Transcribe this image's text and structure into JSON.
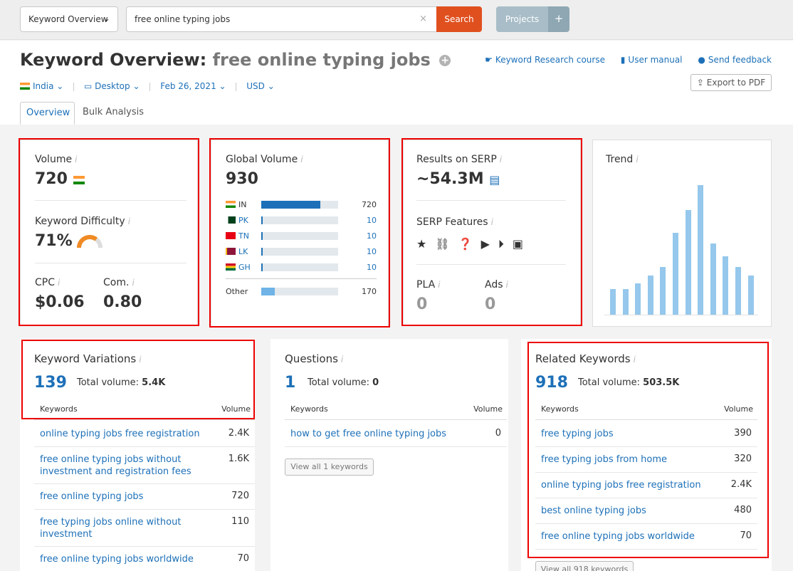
{
  "topbar": {
    "db_select": "Keyword Overview",
    "search_value": "free online typing jobs",
    "search_button": "Search",
    "projects_button": "Projects",
    "plus_button": "+"
  },
  "header": {
    "title_prefix": "Keyword Overview:",
    "title_keyword": "free online typing jobs",
    "links": [
      "Keyword Research course",
      "User manual",
      "Send feedback"
    ],
    "filters": {
      "country": "India",
      "device": "Desktop",
      "date": "Feb 26, 2021",
      "currency": "USD"
    },
    "export_button": "Export to PDF",
    "tabs": [
      "Overview",
      "Bulk Analysis"
    ]
  },
  "volume_card": {
    "volume_label": "Volume",
    "volume_value": "720",
    "kd_label": "Keyword Difficulty",
    "kd_value": "71%",
    "kd_percent": 71,
    "cpc_label": "CPC",
    "cpc_value": "$0.06",
    "com_label": "Com.",
    "com_value": "0.80"
  },
  "global_card": {
    "label": "Global Volume",
    "value": "930",
    "rows": [
      {
        "code": "IN",
        "value": "720",
        "share": 0.77
      },
      {
        "code": "PK",
        "value": "10",
        "share": 0.02
      },
      {
        "code": "TN",
        "value": "10",
        "share": 0.02
      },
      {
        "code": "LK",
        "value": "10",
        "share": 0.02
      },
      {
        "code": "GH",
        "value": "10",
        "share": 0.02
      }
    ],
    "other_label": "Other",
    "other_value": "170",
    "other_share": 0.18
  },
  "serp_card": {
    "results_label": "Results on SERP",
    "results_value": "~54.3M",
    "features_label": "SERP Features",
    "feature_icons": [
      "star-icon",
      "link-icon",
      "question-icon",
      "video-icon",
      "play-icon",
      "briefcase-icon"
    ],
    "pla_label": "PLA",
    "pla_value": "0",
    "ads_label": "Ads",
    "ads_value": "0"
  },
  "trend_card": {
    "label": "Trend",
    "values": [
      0.2,
      0.2,
      0.24,
      0.3,
      0.37,
      0.63,
      0.81,
      1.0,
      0.55,
      0.45,
      0.37,
      0.3
    ]
  },
  "variations": {
    "title": "Keyword Variations",
    "count": "139",
    "total_label": "Total volume: ",
    "total_value": "5.4K",
    "col_kw": "Keywords",
    "col_vol": "Volume",
    "rows": [
      {
        "kw": "online typing jobs free registration",
        "vol": "2.4K"
      },
      {
        "kw": "free online typing jobs without investment and registration fees",
        "vol": "1.6K"
      },
      {
        "kw": "free online typing jobs",
        "vol": "720"
      },
      {
        "kw": "free typing jobs online without investment",
        "vol": "110"
      },
      {
        "kw": "free online typing jobs worldwide",
        "vol": "70"
      }
    ]
  },
  "questions": {
    "title": "Questions",
    "count": "1",
    "total_label": "Total volume: ",
    "total_value": "0",
    "col_kw": "Keywords",
    "col_vol": "Volume",
    "rows": [
      {
        "kw": "how to get free online typing jobs",
        "vol": "0"
      }
    ],
    "view_all": "View all 1 keywords"
  },
  "related": {
    "title": "Related Keywords",
    "count": "918",
    "total_label": "Total volume: ",
    "total_value": "503.5K",
    "col_kw": "Keywords",
    "col_vol": "Volume",
    "rows": [
      {
        "kw": "free typing jobs",
        "vol": "390"
      },
      {
        "kw": "free typing jobs from home",
        "vol": "320"
      },
      {
        "kw": "online typing jobs free registration",
        "vol": "2.4K"
      },
      {
        "kw": "best online typing jobs",
        "vol": "480"
      },
      {
        "kw": "free online typing jobs worldwide",
        "vol": "70"
      }
    ],
    "view_all": "View all 918 keywords"
  }
}
